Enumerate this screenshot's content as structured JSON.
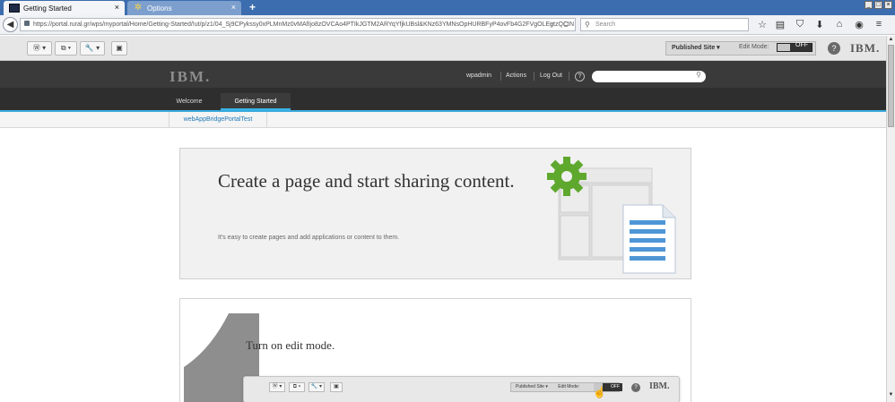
{
  "browser": {
    "tabs": [
      {
        "label": "Getting Started",
        "active": true
      },
      {
        "label": "Options",
        "active": false
      }
    ],
    "new_tab_label": "+",
    "close_glyph": "×",
    "url": "https://portal.rural.gr/wps/myportal/Home/Getting-Started/!ut/p/z1/04_Sj9CPykssy0xPLMnMz0vMAfIjo8zOVCAo4PTIkJGTM2ARYqYfjkUBsl&KNz63YMNsOpHURBFyP4ovFb4G2FVgOLEgtzQCIN",
    "url_dropdown": "▿",
    "reload_glyph": "C",
    "forward_glyph": "→",
    "search_placeholder": "Search",
    "toolbar_icons": [
      "bookmark-star-icon",
      "reading-list-icon",
      "pocket-icon",
      "download-icon",
      "home-icon",
      "chat-icon",
      "menu-icon"
    ],
    "toolbar_glyphs": [
      "☆",
      "▤",
      "⛉",
      "⬇",
      "⌂",
      "◉",
      "≡"
    ],
    "window_controls": [
      "_",
      "□",
      "×"
    ]
  },
  "portal_toolbar": {
    "tools": [
      {
        "name": "wordpress-tool",
        "glyph": "Ⓦ ▾"
      },
      {
        "name": "page-tool",
        "glyph": "⧉ ▾"
      },
      {
        "name": "wrench-tool",
        "glyph": "🔧 ▾"
      },
      {
        "name": "calendar-tool",
        "glyph": "▣"
      }
    ],
    "published_site": "Published Site ▾",
    "edit_mode_label": "Edit Mode:",
    "edit_mode_state": "OFF",
    "help_glyph": "?",
    "logo": "IBM."
  },
  "header": {
    "logo": "IBM.",
    "user": "wpadmin",
    "actions": "Actions",
    "logout": "Log Out",
    "help_glyph": "?",
    "search_glyph": "⚲",
    "nav": [
      {
        "label": "Welcome",
        "active": false
      },
      {
        "label": "Getting Started",
        "active": true
      }
    ]
  },
  "subnav": {
    "items": [
      "webAppBridgePortalTest"
    ]
  },
  "hero": {
    "title": "Create a page and start sharing content.",
    "description": "It's easy to create pages and add applications or content to them."
  },
  "step1": {
    "number": "1",
    "title": "Turn on edit mode.",
    "mini_toolbar": {
      "tools": [
        "Ⓦ ▾",
        "⧉ ▾",
        "🔧 ▾",
        "▣"
      ],
      "published_site": "Published Site ▾",
      "edit_mode_label": "Edit Mode:",
      "edit_mode_state": "OFF",
      "help_glyph": "?",
      "logo": "IBM."
    }
  },
  "colors": {
    "titlebar": "#3c6dae",
    "header_dark": "#2e2e2e",
    "accent_blue": "#39a9dc",
    "gear_green": "#5fa82e",
    "doc_blue": "#4f96d6"
  }
}
